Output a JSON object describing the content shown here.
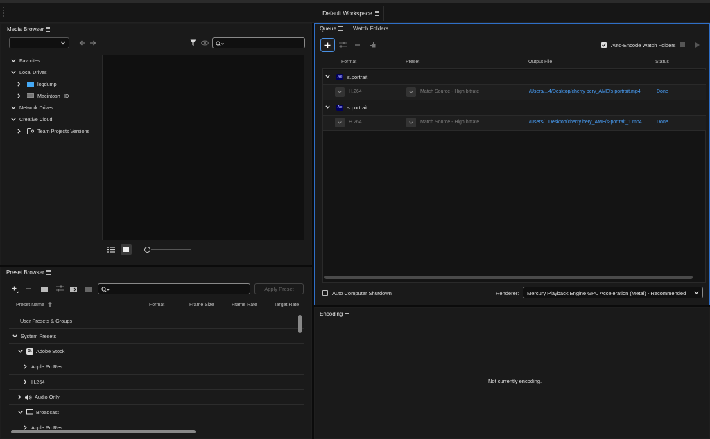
{
  "workspace": {
    "label": "Default Workspace"
  },
  "media_browser": {
    "title": "Media Browser",
    "search_placeholder": "",
    "tree": [
      {
        "label": "Favorites"
      },
      {
        "label": "Local Drives"
      },
      {
        "label": "logdump"
      },
      {
        "label": "Macintosh HD"
      },
      {
        "label": "Network Drives"
      },
      {
        "label": "Creative Cloud"
      },
      {
        "label": "Team Projects Versions"
      }
    ]
  },
  "queue": {
    "tabs": [
      {
        "label": "Queue"
      },
      {
        "label": "Watch Folders"
      }
    ],
    "auto_encode_label": "Auto-Encode Watch Folders",
    "columns": {
      "format": "Format",
      "preset": "Preset",
      "output": "Output File",
      "status": "Status"
    },
    "items": [
      {
        "name": "s.portrait",
        "format": "H.264",
        "preset": "Match Source - High bitrate",
        "output": "/Users/...4/Desktop/cherry bery_AME/s-portrait.mp4",
        "status": "Done"
      },
      {
        "name": "s.portrait",
        "format": "H.264",
        "preset": "Match Source - High bitrate",
        "output": "/Users/...Desktop/cherry bery_AME/s-portrait_1.mp4",
        "status": "Done"
      }
    ],
    "auto_shutdown_label": "Auto Computer Shutdown",
    "renderer_label": "Renderer:",
    "renderer_value": "Mercury Playback Engine GPU Acceleration (Metal) - Recommended"
  },
  "preset_browser": {
    "title": "Preset Browser",
    "apply_label": "Apply Preset",
    "columns": {
      "name": "Preset Name",
      "format": "Format",
      "frame_size": "Frame Size",
      "frame_rate": "Frame Rate",
      "target_rate": "Target Rate"
    },
    "rows": [
      {
        "label": "User Presets & Groups"
      },
      {
        "label": "System Presets"
      },
      {
        "label": "Adobe Stock"
      },
      {
        "label": "Apple ProRes"
      },
      {
        "label": "H.264"
      },
      {
        "label": "Audio Only"
      },
      {
        "label": "Broadcast"
      },
      {
        "label": "Apple ProRes"
      }
    ]
  },
  "encoding": {
    "title": "Encoding",
    "status": "Not currently encoding."
  },
  "badges": {
    "ae": "Ae",
    "st": "St"
  },
  "colors": {
    "accent": "#4aa3ff",
    "panel_border_active": "#2f6fc7"
  }
}
